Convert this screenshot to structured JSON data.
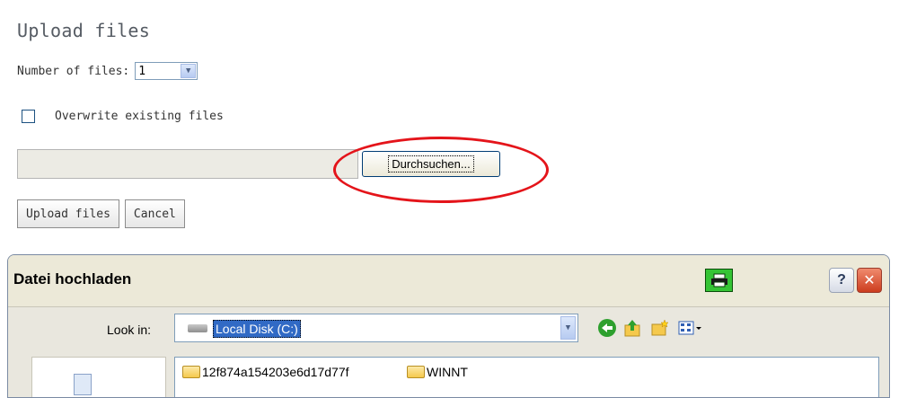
{
  "upload": {
    "title": "Upload files",
    "number_label": "Number of files:",
    "number_value": "1",
    "overwrite_label": "Overwrite existing files",
    "overwrite_checked": false,
    "browse_label": "Durchsuchen...",
    "file_path_value": "",
    "upload_button": "Upload files",
    "cancel_button": "Cancel"
  },
  "annotation": {
    "highlight_color": "#e4141a"
  },
  "dialog": {
    "title": "Datei hochladen",
    "help_label": "?",
    "close_label": "✕",
    "look_in_label": "Look in:",
    "look_in_value": "Local Disk (C:)",
    "files": [
      {
        "name": "12f874a154203e6d17d77f"
      },
      {
        "name": "WINNT"
      }
    ]
  },
  "colors": {
    "title_text": "#555b63",
    "dialog_bg": "#ece9d8",
    "selection": "#316ac5",
    "close_button": "#cc3d1e",
    "printer_icon": "#35c435"
  },
  "icons": [
    "dropdown-arrow-icon",
    "printer-icon",
    "help-icon",
    "close-icon",
    "disk-drive-icon",
    "back-icon",
    "up-folder-icon",
    "new-folder-icon",
    "view-menu-icon",
    "folder-icon",
    "document-icon"
  ]
}
